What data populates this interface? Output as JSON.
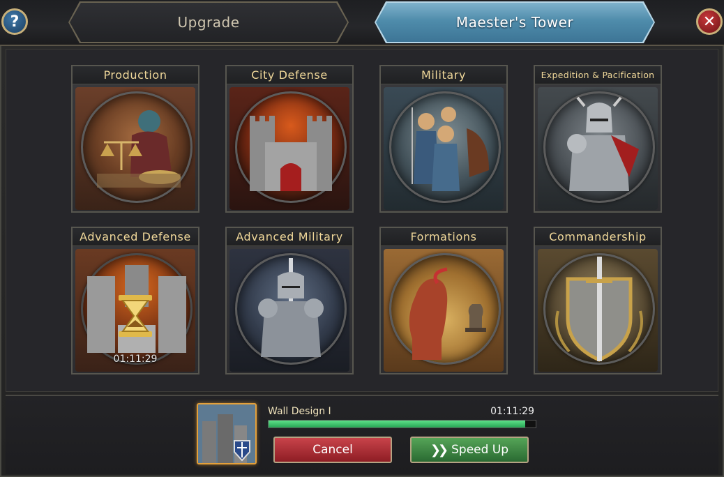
{
  "tabs": {
    "upgrade": "Upgrade",
    "maester": "Maester's Tower"
  },
  "buttons": {
    "help": "?",
    "close": "✕"
  },
  "cards": [
    {
      "title": "Production",
      "icon": "scales-merchant-icon"
    },
    {
      "title": "City Defense",
      "icon": "castle-icon"
    },
    {
      "title": "Military",
      "icon": "soldiers-icon"
    },
    {
      "title": "Expedition & Pacification",
      "icon": "armored-knight-icon"
    },
    {
      "title": "Advanced Defense",
      "icon": "fortress-icon",
      "timer": "01:11:29"
    },
    {
      "title": "Advanced Military",
      "icon": "knight-sword-icon"
    },
    {
      "title": "Formations",
      "icon": "chess-pieces-icon"
    },
    {
      "title": "Commandership",
      "icon": "shield-sword-icon"
    }
  ],
  "research": {
    "name": "Wall Design I",
    "timer": "01:11:29",
    "progress": 0.96,
    "cancel_label": "Cancel",
    "speedup_label": "Speed Up"
  },
  "colors": {
    "tab_active": "#4f8cab",
    "title_gold": "#f0d89a",
    "progress_green": "#3bbf6a",
    "cancel_red": "#b0323a",
    "speedup_green": "#3f8a45"
  }
}
